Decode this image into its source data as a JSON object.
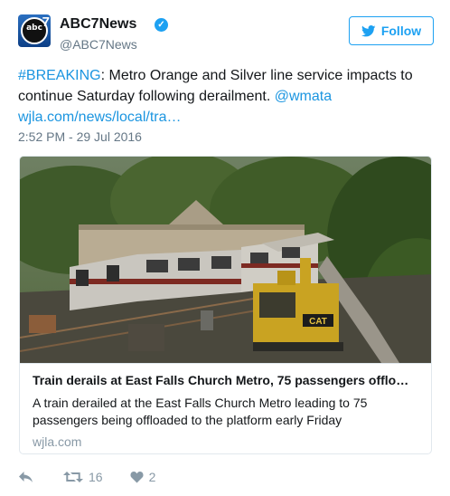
{
  "account": {
    "name": "ABC7News",
    "handle": "@ABC7News",
    "avatar_text": "abc",
    "avatar_number": "7"
  },
  "follow_button": {
    "label": "Follow",
    "icon": "twitter-bird-icon"
  },
  "tweet": {
    "hashtag": "#BREAKING",
    "text_main": ": Metro Orange and Silver line service impacts to continue Saturday following derailment. ",
    "mention": "@wmata",
    "link": "wjla.com/news/local/tra…",
    "timestamp": "2:52 PM - 29 Jul 2016"
  },
  "card": {
    "title": "Train derails at East Falls Church Metro, 75 passengers offlo…",
    "description": "A train derailed at the East Falls Church Metro leading to 75 passengers being offloaded to the platform early Friday",
    "domain": "wjla.com",
    "image_sign": "CAT"
  },
  "actions": {
    "reply_icon": "reply-icon",
    "retweet_icon": "retweet-icon",
    "retweet_count": "16",
    "like_icon": "heart-icon",
    "like_count": "2"
  },
  "colors": {
    "link": "#1b95e0",
    "follow": "#1da1f2",
    "muted": "#657786"
  }
}
